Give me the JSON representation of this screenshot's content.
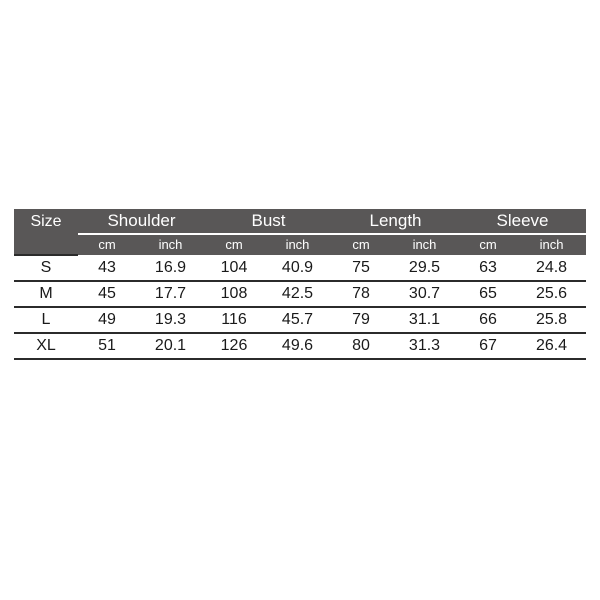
{
  "table": {
    "size_column_label": "Size",
    "groups": [
      {
        "label": "Shoulder"
      },
      {
        "label": "Bust"
      },
      {
        "label": "Length"
      },
      {
        "label": "Sleeve"
      }
    ],
    "unit_labels": {
      "cm": "cm",
      "inch": "inch"
    },
    "units_row": [
      "cm",
      "inch",
      "cm",
      "inch",
      "cm",
      "inch",
      "cm",
      "inch"
    ],
    "rows": [
      {
        "size": "S",
        "shoulder_cm": "43",
        "shoulder_inch": "16.9",
        "bust_cm": "104",
        "bust_inch": "40.9",
        "length_cm": "75",
        "length_inch": "29.5",
        "sleeve_cm": "63",
        "sleeve_inch": "24.8"
      },
      {
        "size": "M",
        "shoulder_cm": "45",
        "shoulder_inch": "17.7",
        "bust_cm": "108",
        "bust_inch": "42.5",
        "length_cm": "78",
        "length_inch": "30.7",
        "sleeve_cm": "65",
        "sleeve_inch": "25.6"
      },
      {
        "size": "L",
        "shoulder_cm": "49",
        "shoulder_inch": "19.3",
        "bust_cm": "116",
        "bust_inch": "45.7",
        "length_cm": "79",
        "length_inch": "31.1",
        "sleeve_cm": "66",
        "sleeve_inch": "25.8"
      },
      {
        "size": "XL",
        "shoulder_cm": "51",
        "shoulder_inch": "20.1",
        "bust_cm": "126",
        "bust_inch": "49.6",
        "length_cm": "80",
        "length_inch": "31.3",
        "sleeve_cm": "67",
        "sleeve_inch": "26.4"
      }
    ]
  },
  "colors": {
    "page_background": "#ffffff",
    "header_background": "#595757",
    "header_text": "#ffffff",
    "body_text": "#1a1a1a",
    "rule": "#2b2b2b",
    "header_rule": "#ffffff"
  }
}
